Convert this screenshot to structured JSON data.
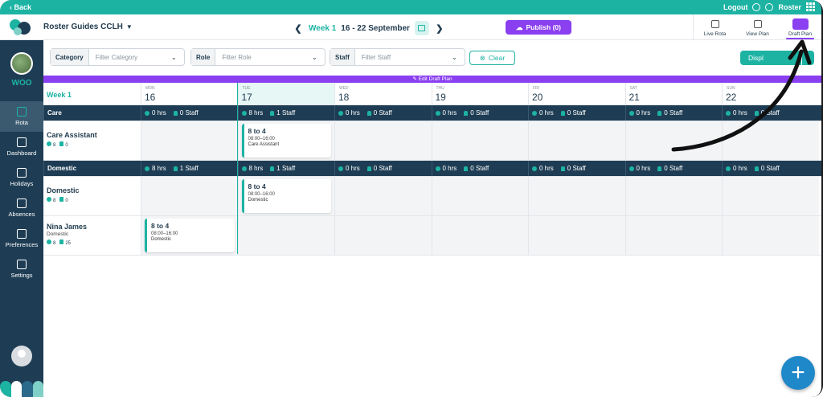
{
  "topbar": {
    "back_label": "‹ Back",
    "logout_label": "Logout",
    "roster_label": "Roster"
  },
  "header": {
    "title": "Roster Guides CCLH",
    "week_label": "Week 1",
    "date_range": "16 - 22 September",
    "publish_label": "Publish (0)",
    "plan_tabs": [
      {
        "label": "Live Rota",
        "icon": "calendar-check-icon"
      },
      {
        "label": "View Plan",
        "icon": "briefcase-icon"
      },
      {
        "label": "Draft Plan",
        "icon": "pencil-icon",
        "active": true
      }
    ]
  },
  "sidebar": {
    "org_name": "WOO",
    "items": [
      {
        "label": "Rota",
        "icon": "calendar-icon",
        "active": true
      },
      {
        "label": "Dashboard",
        "icon": "dashboard-icon"
      },
      {
        "label": "Holidays",
        "icon": "holiday-icon"
      },
      {
        "label": "Absences",
        "icon": "absence-icon"
      },
      {
        "label": "Preferences",
        "icon": "preferences-icon"
      },
      {
        "label": "Settings",
        "icon": "gear-icon"
      }
    ]
  },
  "filters": {
    "category_label": "Category",
    "category_placeholder": "Filter Category",
    "role_label": "Role",
    "role_placeholder": "Filter Role",
    "staff_label": "Staff",
    "staff_placeholder": "Filter Staff",
    "clear_label": "Clear",
    "display_label": "Displ"
  },
  "banner": {
    "label": "✎ Edit Draft Plan"
  },
  "grid": {
    "week_label": "Week 1",
    "days": [
      {
        "abbr": "MON",
        "num": "16"
      },
      {
        "abbr": "TUE",
        "num": "17"
      },
      {
        "abbr": "WED",
        "num": "18"
      },
      {
        "abbr": "THU",
        "num": "19"
      },
      {
        "abbr": "FRI",
        "num": "20"
      },
      {
        "abbr": "SAT",
        "num": "21"
      },
      {
        "abbr": "SUN",
        "num": "22"
      }
    ],
    "sections": [
      {
        "name": "Care",
        "totals": [
          {
            "hrs": "0 hrs",
            "staff": "0 Staff"
          },
          {
            "hrs": "8 hrs",
            "staff": "1 Staff"
          },
          {
            "hrs": "0 hrs",
            "staff": "0 Staff"
          },
          {
            "hrs": "0 hrs",
            "staff": "0 Staff"
          },
          {
            "hrs": "0 hrs",
            "staff": "0 Staff"
          },
          {
            "hrs": "0 hrs",
            "staff": "0 Staff"
          },
          {
            "hrs": "0 hrs",
            "staff": "0 Staff"
          }
        ],
        "rows": [
          {
            "name": "Care Assistant",
            "role": "",
            "stat_hours": "8",
            "stat_count": "0",
            "shifts": {
              "1": {
                "title": "8 to 4",
                "hours": "08:00–16:00",
                "role": "Care Assistant"
              }
            }
          }
        ]
      },
      {
        "name": "Domestic",
        "totals": [
          {
            "hrs": "8 hrs",
            "staff": "1 Staff"
          },
          {
            "hrs": "8 hrs",
            "staff": "1 Staff"
          },
          {
            "hrs": "0 hrs",
            "staff": "0 Staff"
          },
          {
            "hrs": "0 hrs",
            "staff": "0 Staff"
          },
          {
            "hrs": "0 hrs",
            "staff": "0 Staff"
          },
          {
            "hrs": "0 hrs",
            "staff": "0 Staff"
          },
          {
            "hrs": "0 hrs",
            "staff": "0 Staff"
          }
        ],
        "rows": [
          {
            "name": "Domestic",
            "role": "",
            "stat_hours": "8",
            "stat_count": "0",
            "shifts": {
              "1": {
                "title": "8 to 4",
                "hours": "08:00–16:00",
                "role": "Domestic"
              }
            }
          },
          {
            "name": "Nina James",
            "role": "Domestic",
            "stat_hours": "8",
            "stat_count": "25",
            "shifts": {
              "0": {
                "title": "8 to 4",
                "hours": "08:00–16:00",
                "role": "Domestic"
              }
            }
          }
        ]
      }
    ]
  },
  "colors": {
    "teal": "#1db3a3",
    "navy": "#1e3d54",
    "purple": "#8a3ff0",
    "fab_blue": "#1e88c8"
  }
}
